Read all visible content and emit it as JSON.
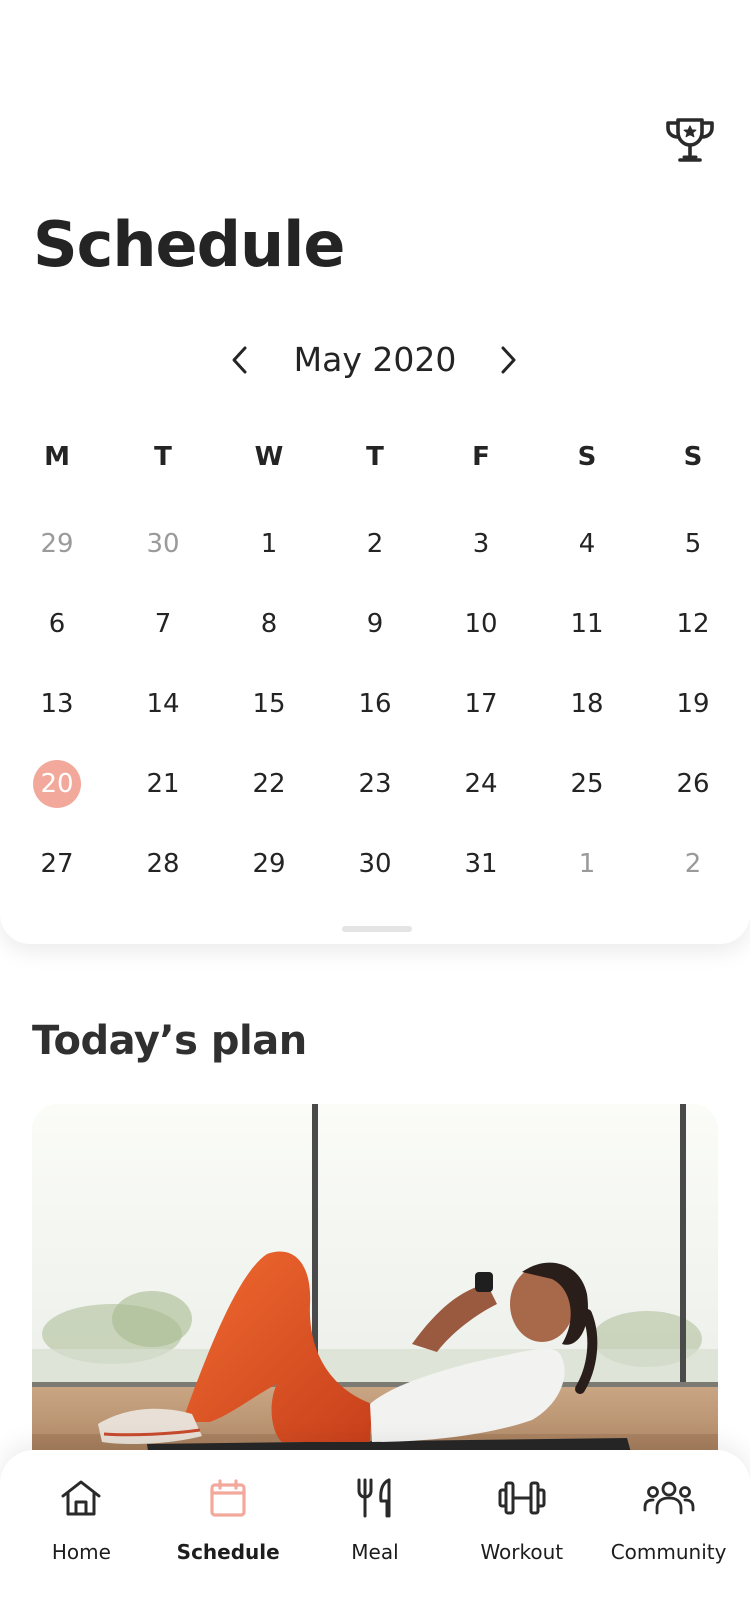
{
  "header": {
    "title": "Schedule",
    "trophy_icon": "trophy-icon"
  },
  "calendar": {
    "month_label": "May 2020",
    "weekdays": [
      "M",
      "T",
      "W",
      "T",
      "F",
      "S",
      "S"
    ],
    "weeks": [
      [
        "29",
        "30",
        "1",
        "2",
        "3",
        "4",
        "5"
      ],
      [
        "6",
        "7",
        "8",
        "9",
        "10",
        "11",
        "12"
      ],
      [
        "13",
        "14",
        "15",
        "16",
        "17",
        "18",
        "19"
      ],
      [
        "20",
        "21",
        "22",
        "23",
        "24",
        "25",
        "26"
      ],
      [
        "27",
        "28",
        "29",
        "30",
        "31",
        "1",
        "2"
      ]
    ],
    "selected_day": "20",
    "selected_color": "#f2a99b"
  },
  "plan": {
    "title": "Today’s plan"
  },
  "bottom_nav": {
    "active_color": "#f2a99b",
    "items": [
      {
        "label": "Home",
        "icon": "home-icon"
      },
      {
        "label": "Schedule",
        "icon": "calendar-icon"
      },
      {
        "label": "Meal",
        "icon": "utensils-icon"
      },
      {
        "label": "Workout",
        "icon": "dumbbell-icon"
      },
      {
        "label": "Community",
        "icon": "people-icon"
      }
    ]
  }
}
